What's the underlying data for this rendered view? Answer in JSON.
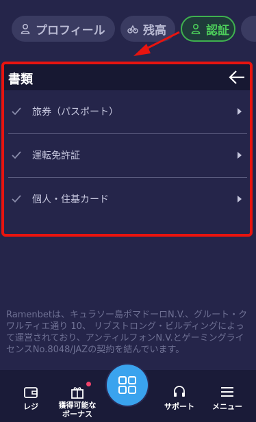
{
  "tabs": [
    {
      "label": "プロフィール",
      "icon": "user-icon"
    },
    {
      "label": "残高",
      "icon": "balance-icon"
    },
    {
      "label": "認証",
      "icon": "verify-icon"
    }
  ],
  "panel": {
    "title": "書類",
    "back_icon": "arrow-left-icon"
  },
  "documents": [
    {
      "label": "旅券（パスポート）"
    },
    {
      "label": "運転免許証"
    },
    {
      "label": "個人・住基カード"
    }
  ],
  "legal_text": "Ramenbetは、キュラソー島ポマドーロN.V.、グルート・クワルティエ通り 10、 リブストロング・ビルディングによって運営されており、アンティルフォンN.V.とゲーミングライセンスNo.8048/JAZの契約を結んでいます。",
  "bottom_nav": {
    "register": "レジ",
    "bonus": "獲得可能なボーナス",
    "support": "サポート",
    "menu": "メニュー"
  },
  "colors": {
    "accent_green": "#4ccc5a",
    "highlight_red": "#e8140f",
    "center_button": "#3aa3ee"
  }
}
